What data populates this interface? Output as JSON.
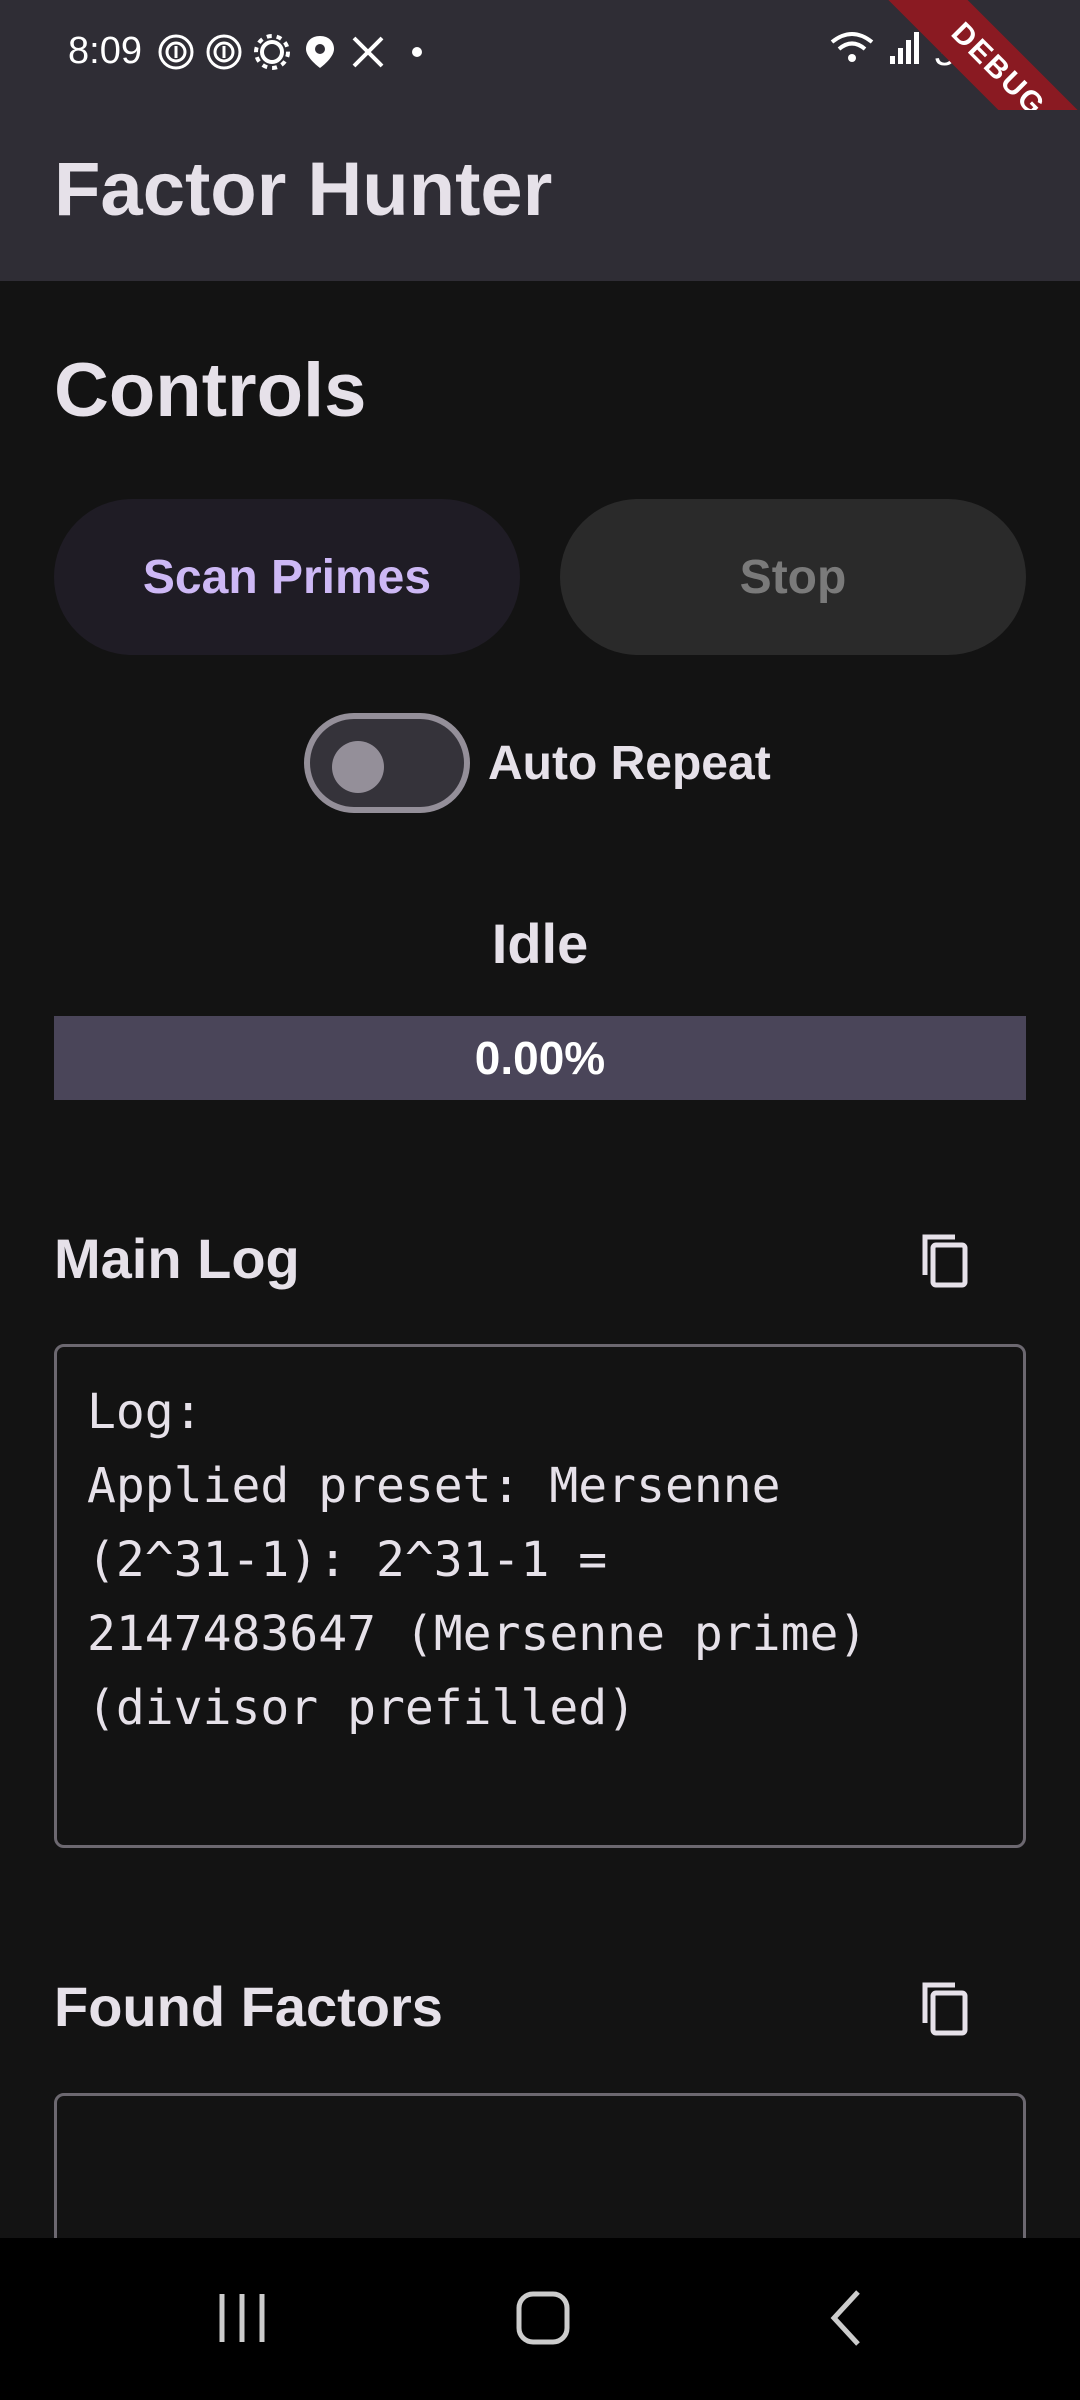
{
  "status_bar": {
    "time": "8:09",
    "battery": "34%",
    "icons_left": [
      "fingerprint-icon",
      "fingerprint-icon",
      "settings-icon",
      "location-pin-icon",
      "tools-icon",
      "dot-icon"
    ],
    "icons_right": [
      "wifi-icon",
      "signal-icon",
      "battery-icon"
    ]
  },
  "debug_banner": "DEBUG",
  "app_bar": {
    "title": "Factor Hunter"
  },
  "controls": {
    "title": "Controls",
    "scan_label": "Scan Primes",
    "stop_label": "Stop",
    "auto_repeat_label": "Auto Repeat",
    "auto_repeat_on": false,
    "status": "Idle",
    "progress_fraction": 0.0,
    "progress_label": "0.00%"
  },
  "main_log": {
    "title": "Main Log",
    "text": "Log:\nApplied preset: Mersenne\n(2^31-1): 2^31-1 =\n2147483647 (Mersenne prime)\n(divisor prefilled)"
  },
  "found_factors": {
    "title": "Found Factors",
    "text": ""
  },
  "colors": {
    "background": "#131313",
    "app_bar": "#2f2d35",
    "accent": "#cdb8f5",
    "progress_track": "#4a4559",
    "debug": "#8a1a22"
  }
}
